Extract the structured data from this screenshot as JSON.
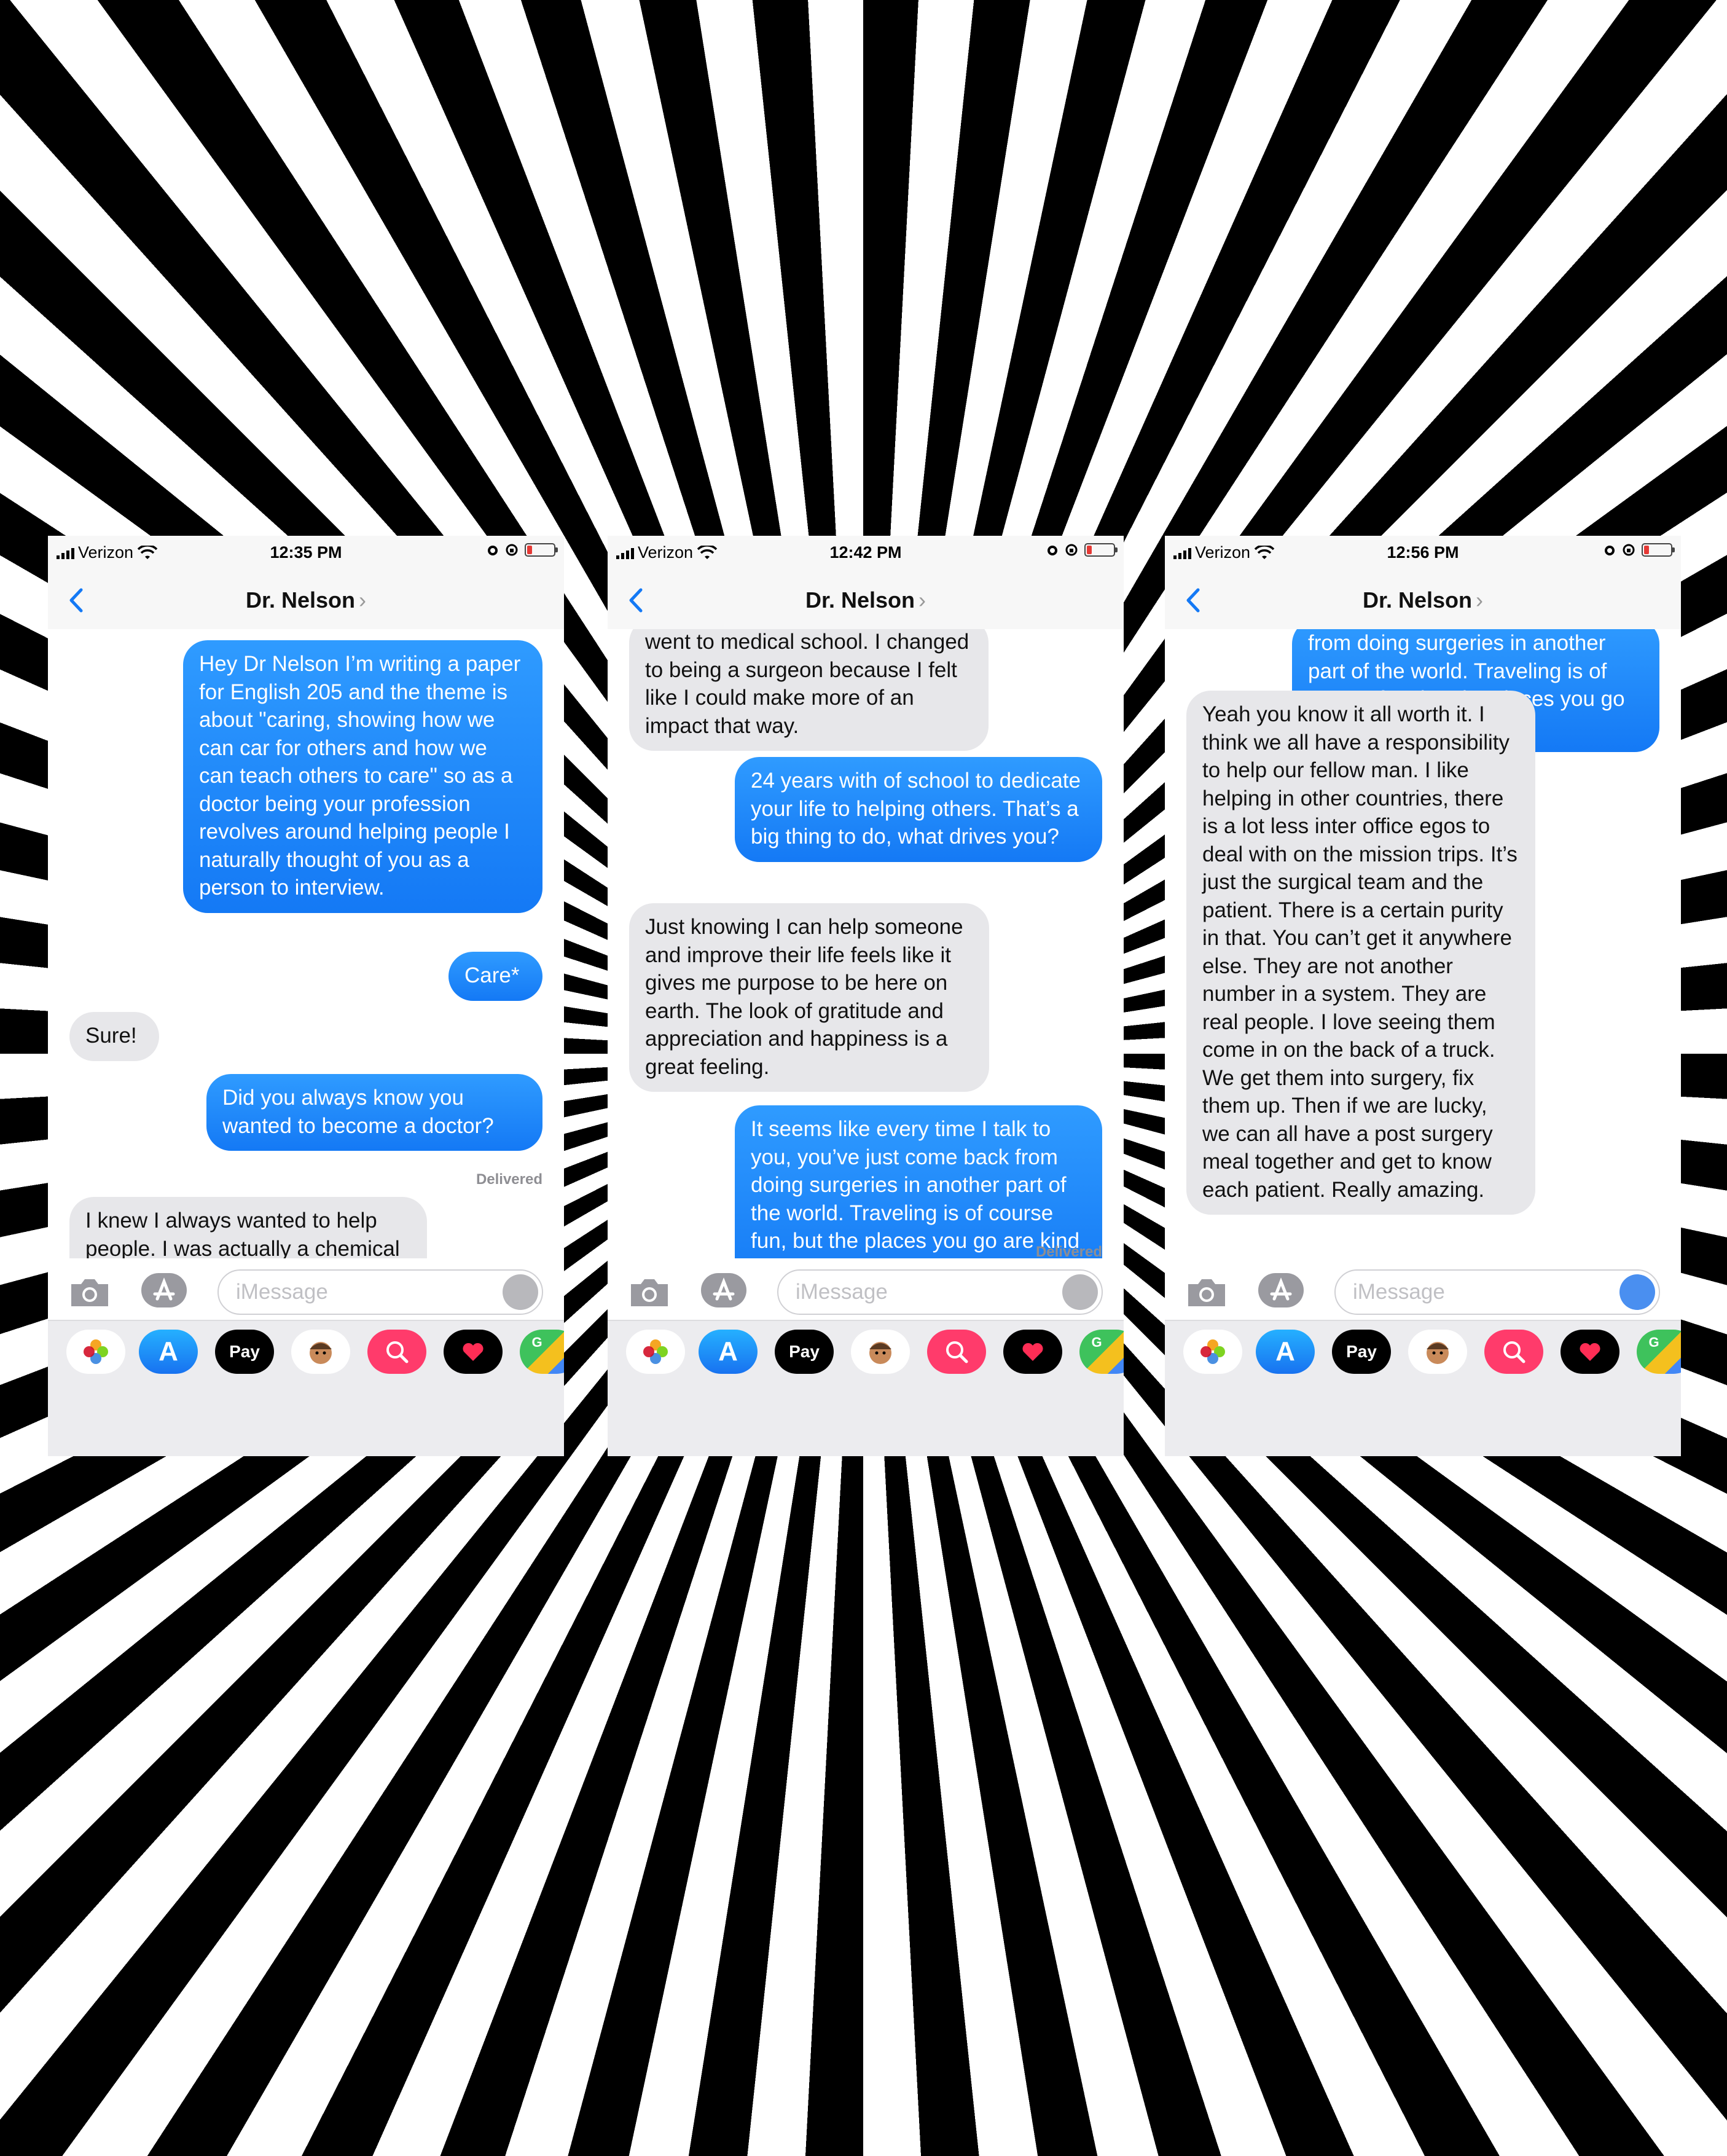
{
  "colors": {
    "outgoing_bubble": "#1d87ff",
    "incoming_bubble": "#e7e7ea",
    "ios_blue": "#1479f5",
    "background_stripes": [
      "#000000",
      "#ffffff"
    ]
  },
  "screens": [
    {
      "status": {
        "carrier": "Verizon",
        "time": "12:35 PM"
      },
      "contact": "Dr. Nelson",
      "input_placeholder": "iMessage",
      "messages": [
        {
          "from": "me",
          "text": "Hey Dr Nelson I’m writing a paper for English 205 and the theme is about \"caring, showing how we can car for others and how we can teach others to care\" so as a doctor being your profession revolves around helping people I naturally thought of you as a person to interview."
        },
        {
          "from": "me",
          "text": "Care*"
        },
        {
          "from": "them",
          "text": "Sure!"
        },
        {
          "from": "me",
          "text": "Did you always know you wanted to become a doctor?"
        },
        {
          "from": "them",
          "text": "I knew I always wanted to help people. I was actually a chemical engineer before I went to medical school. I changed to being a surgeon"
        }
      ],
      "receipt": "Delivered"
    },
    {
      "status": {
        "carrier": "Verizon",
        "time": "12:42 PM"
      },
      "contact": "Dr. Nelson",
      "input_placeholder": "iMessage",
      "messages": [
        {
          "from": "them",
          "text": "went to medical school. I changed to being a surgeon because I felt like I could make more of an impact that way."
        },
        {
          "from": "me",
          "text": "24 years with of school to dedicate your life to helping others. That’s a big thing to do, what drives you?"
        },
        {
          "from": "them",
          "text": "Just knowing I can help someone and improve their life feels like it gives me purpose to be here on earth. The look of gratitude and appreciation and happiness is a great feeling."
        },
        {
          "from": "me",
          "text": "It seems like every time I talk to you, you’ve just come back from doing surgeries in another part of the world. Traveling is of course fun, but the places you go are kind of risky."
        }
      ],
      "receipt": "Delivered"
    },
    {
      "status": {
        "carrier": "Verizon",
        "time": "12:56 PM"
      },
      "contact": "Dr. Nelson",
      "input_placeholder": "iMessage",
      "messages": [
        {
          "from": "me",
          "text": "from doing surgeries in another part of the world. Traveling is of course fun, but the places you go are kind of risky."
        },
        {
          "from": "them",
          "text": "Yeah you know it all worth it. I think we all have a responsibility to help our fellow man. I like helping in other countries, there is a lot less inter office egos to deal with on the mission trips. It’s just the surgical team and the patient. There is a certain purity in that. You can’t get it anywhere else. They are not another number in a system. They are real people. I love seeing them come in on the back of a truck. We get them into surgery, fix them up. Then if we are lucky, we can all have a post surgery meal together and get to know each patient. Really amazing."
        }
      ]
    }
  ],
  "app_strip": [
    "photos-icon",
    "app-store-icon",
    "apple-pay-icon",
    "memoji-icon",
    "web-search-icon",
    "digital-touch-icon",
    "maps-icon"
  ],
  "app_strip_labels": {
    "apple_pay": "Pay"
  }
}
